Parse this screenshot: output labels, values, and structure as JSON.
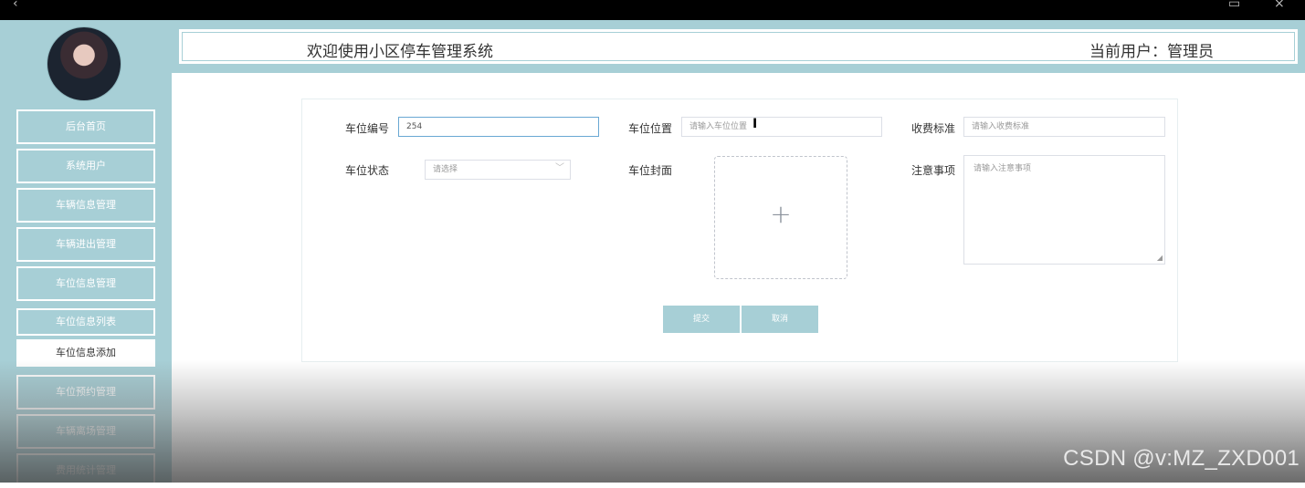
{
  "sidebar": {
    "items": [
      {
        "label": "后台首页"
      },
      {
        "label": "系统用户"
      },
      {
        "label": "车辆信息管理"
      },
      {
        "label": "车辆进出管理"
      },
      {
        "label": "车位信息管理"
      },
      {
        "label": "车位信息列表"
      },
      {
        "label": "车位信息添加"
      },
      {
        "label": "车位预约管理"
      },
      {
        "label": "车辆离场管理"
      },
      {
        "label": "费用统计管理"
      }
    ]
  },
  "header": {
    "title": "欢迎使用小区停车管理系统",
    "user": "当前用户：管理员"
  },
  "form": {
    "space_no_label": "车位编号",
    "space_no_value": "254",
    "location_label": "车位位置",
    "location_placeholder": "请输入车位位置",
    "fee_label": "收费标准",
    "fee_placeholder": "请输入收费标准",
    "status_label": "车位状态",
    "status_placeholder": "请选择",
    "cover_label": "车位封面",
    "notes_label": "注意事项",
    "notes_placeholder": "请输入注意事项",
    "submit_label": "提交",
    "cancel_label": "取消"
  },
  "watermark": "CSDN @v:MZ_ZXD001",
  "colors": {
    "accent": "#a7cfd6",
    "topbar": "#000000"
  }
}
